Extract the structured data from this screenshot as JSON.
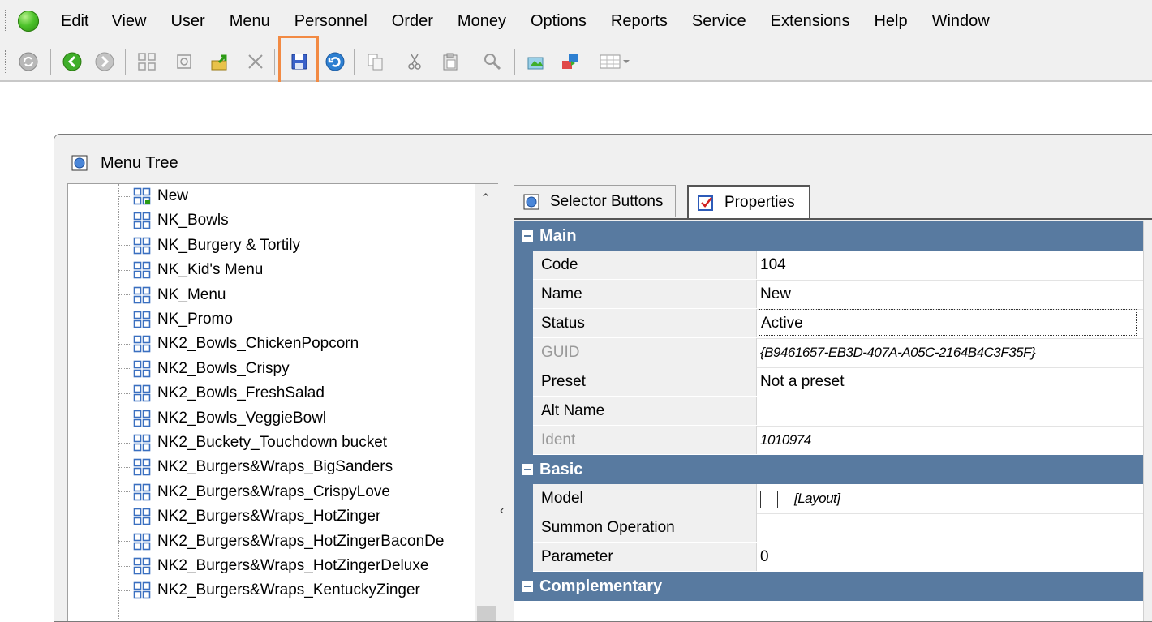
{
  "menu": {
    "items": [
      "Edit",
      "View",
      "User",
      "Menu",
      "Personnel",
      "Order",
      "Money",
      "Options",
      "Reports",
      "Service",
      "Extensions",
      "Help",
      "Window"
    ]
  },
  "toolbar": {
    "buttons": [
      "refresh-icon",
      "back-icon",
      "forward-icon",
      "grid-icon",
      "new-doc-icon",
      "export-icon",
      "delete-icon",
      "save-icon",
      "undo-icon",
      "copy-icon",
      "cut-icon",
      "paste-icon",
      "search-icon",
      "image-icon",
      "transfer-icon",
      "table-dropdown-icon"
    ],
    "highlighted": "save-icon"
  },
  "window": {
    "title": "Menu Tree"
  },
  "tree": {
    "items": [
      "New",
      "NK_Bowls",
      "NK_Burgery & Tortily",
      "NK_Kid's Menu",
      "NK_Menu",
      "NK_Promo",
      "NK2_Bowls_ChickenPopcorn",
      "NK2_Bowls_Crispy",
      "NK2_Bowls_FreshSalad",
      "NK2_Bowls_VeggieBowl",
      "NK2_Buckety_Touchdown bucket",
      "NK2_Burgers&Wraps_BigSanders",
      "NK2_Burgers&Wraps_CrispyLove",
      "NK2_Burgers&Wraps_HotZinger",
      "NK2_Burgers&Wraps_HotZingerBaconDe",
      "NK2_Burgers&Wraps_HotZingerDeluxe",
      "NK2_Burgers&Wraps_KentuckyZinger"
    ]
  },
  "tabs": {
    "selector_buttons": "Selector Buttons",
    "properties": "Properties"
  },
  "properties": {
    "main": {
      "title": "Main",
      "code_label": "Code",
      "code_value": "104",
      "name_label": "Name",
      "name_value": "New",
      "status_label": "Status",
      "status_value": "Active",
      "guid_label": "GUID",
      "guid_value": "{B9461657-EB3D-407A-A05C-2164B4C3F35F}",
      "preset_label": "Preset",
      "preset_value": "Not a preset",
      "altname_label": "Alt Name",
      "altname_value": "",
      "ident_label": "Ident",
      "ident_value": "1010974"
    },
    "basic": {
      "title": "Basic",
      "model_label": "Model",
      "model_value": "[Layout]",
      "summon_label": "Summon Operation",
      "summon_value": "",
      "parameter_label": "Parameter",
      "parameter_value": "0"
    },
    "complementary": {
      "title": "Complementary"
    }
  },
  "colors": {
    "category_bar": "#587aa0",
    "highlight_box": "#f28a43",
    "window_bg": "#f0f0f0"
  }
}
